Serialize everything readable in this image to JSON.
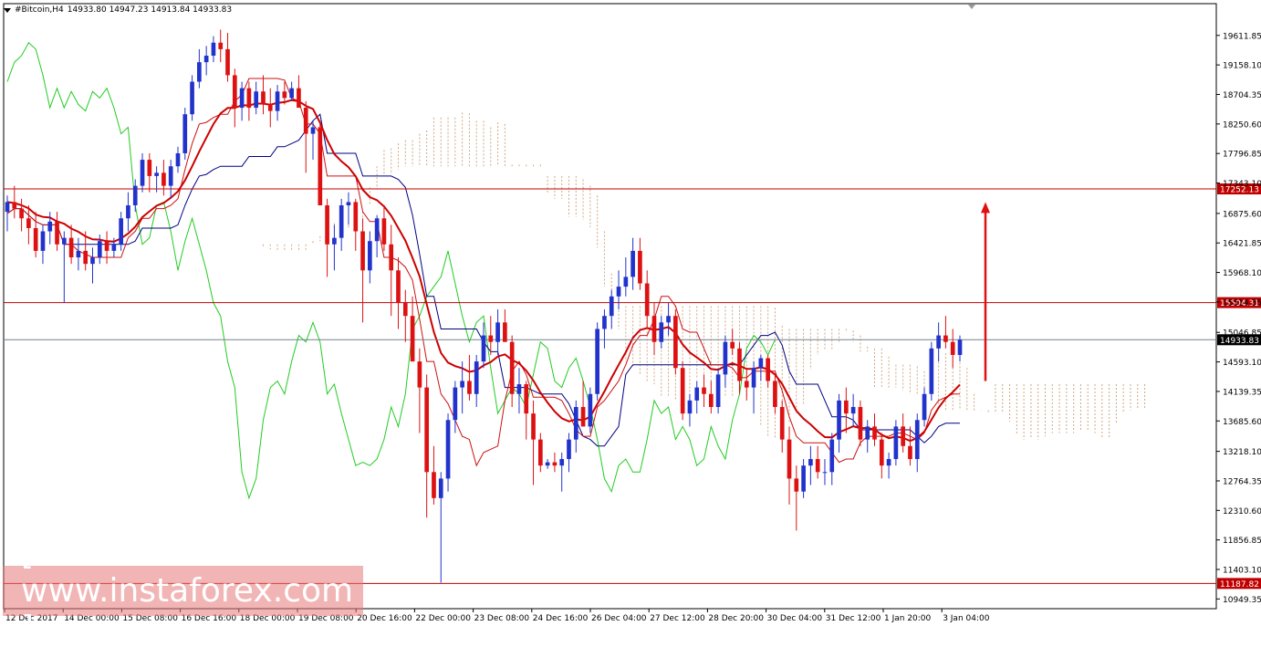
{
  "header": {
    "symbol": "#Bitcoin,H4",
    "ohlc": "14933.80 14947.23 14913.84 14933.83"
  },
  "watermark": {
    "text": "[ www.instaforex.com ]"
  },
  "chart_data": {
    "type": "candlestick",
    "y_axis_ticks": [
      "19611.85",
      "19158.10",
      "18704.35",
      "18250.60",
      "17796.85",
      "17343.10",
      "16875.60",
      "16421.85",
      "15968.10",
      "15514.35",
      "15046.85",
      "14593.10",
      "14139.35",
      "13685.60",
      "13218.10",
      "12764.35",
      "12310.60",
      "11856.85",
      "11403.10",
      "10949.35"
    ],
    "y_axis_tick_values": [
      19611.85,
      19158.1,
      18704.35,
      18250.6,
      17796.85,
      17343.1,
      16875.6,
      16421.85,
      15968.1,
      15514.35,
      15046.85,
      14593.1,
      14139.35,
      13685.6,
      13218.1,
      12764.35,
      12310.6,
      11856.85,
      11403.1,
      10949.35
    ],
    "ylim": [
      10800,
      20100
    ],
    "x_axis_labels": [
      "12 Dec 2017",
      "14 Dec 00:00",
      "15 Dec 08:00",
      "16 Dec 16:00",
      "18 Dec 00:00",
      "19 Dec 08:00",
      "20 Dec 16:00",
      "22 Dec 00:00",
      "23 Dec 08:00",
      "24 Dec 16:00",
      "26 Dec 04:00",
      "27 Dec 12:00",
      "28 Dec 20:00",
      "30 Dec 04:00",
      "31 Dec 12:00",
      "1 Jan 20:00",
      "3 Jan 04:00"
    ],
    "horizontal_levels": [
      {
        "value": 17252.13,
        "label": "17252.13",
        "color": "#c00000"
      },
      {
        "value": 15504.31,
        "label": "15504.31",
        "color": "#c00000"
      },
      {
        "value": 11187.82,
        "label": "11187.82",
        "color": "#c00000"
      }
    ],
    "current_price": {
      "value": 14933.83,
      "label": "14933.83"
    },
    "forecast_arrow": {
      "from": 14300,
      "to": 17050,
      "color": "#e01010"
    },
    "colors": {
      "bull": "#2233cc",
      "bear": "#dd1111",
      "tenkan": "#cc1111",
      "kijun": "#000080",
      "chikou": "#22cc22",
      "ma": "#cc0000",
      "cloud": "#c89060"
    },
    "candles": [
      [
        16900,
        17150,
        16600,
        17050
      ],
      [
        17050,
        17300,
        16800,
        16950
      ],
      [
        16950,
        17100,
        16600,
        16800
      ],
      [
        16800,
        17000,
        16400,
        16650
      ],
      [
        16650,
        16900,
        16200,
        16300
      ],
      [
        16300,
        16700,
        16100,
        16600
      ],
      [
        16600,
        16900,
        16400,
        16750
      ],
      [
        16750,
        16900,
        16300,
        16400
      ],
      [
        16400,
        16600,
        15500,
        16500
      ],
      [
        16500,
        16700,
        16100,
        16200
      ],
      [
        16200,
        16500,
        16000,
        16300
      ],
      [
        16300,
        16600,
        16000,
        16100
      ],
      [
        16100,
        16350,
        15800,
        16200
      ],
      [
        16200,
        16550,
        16100,
        16450
      ],
      [
        16450,
        16600,
        16100,
        16300
      ],
      [
        16300,
        16500,
        16200,
        16400
      ],
      [
        16400,
        16900,
        16300,
        16800
      ],
      [
        16800,
        17200,
        16600,
        17000
      ],
      [
        17000,
        17400,
        16900,
        17300
      ],
      [
        17300,
        17800,
        17200,
        17700
      ],
      [
        17700,
        17800,
        17200,
        17450
      ],
      [
        17450,
        17600,
        17200,
        17500
      ],
      [
        17500,
        17700,
        17150,
        17300
      ],
      [
        17300,
        17700,
        17100,
        17600
      ],
      [
        17600,
        17900,
        17500,
        17800
      ],
      [
        17800,
        18500,
        17700,
        18400
      ],
      [
        18400,
        19000,
        18300,
        18900
      ],
      [
        18900,
        19400,
        18800,
        19200
      ],
      [
        19200,
        19450,
        19000,
        19300
      ],
      [
        19300,
        19600,
        19200,
        19500
      ],
      [
        19500,
        19700,
        19200,
        19400
      ],
      [
        19400,
        19650,
        18900,
        19000
      ],
      [
        19000,
        19100,
        18200,
        18500
      ],
      [
        18500,
        18900,
        18300,
        18800
      ],
      [
        18800,
        18900,
        18300,
        18500
      ],
      [
        18500,
        18900,
        18400,
        18750
      ],
      [
        18750,
        19000,
        18400,
        18550
      ],
      [
        18550,
        18800,
        18200,
        18450
      ],
      [
        18450,
        18850,
        18300,
        18750
      ],
      [
        18750,
        18900,
        18550,
        18650
      ],
      [
        18650,
        18900,
        18600,
        18800
      ],
      [
        18800,
        19000,
        18500,
        18500
      ],
      [
        18500,
        18600,
        17500,
        18100
      ],
      [
        18100,
        18300,
        17700,
        18200
      ],
      [
        18200,
        18300,
        17200,
        17000
      ],
      [
        17000,
        17100,
        15900,
        16400
      ],
      [
        16400,
        16700,
        16000,
        16500
      ],
      [
        16500,
        17100,
        16300,
        17000
      ],
      [
        17000,
        17200,
        16700,
        17050
      ],
      [
        17050,
        17100,
        16300,
        16600
      ],
      [
        16600,
        16800,
        15200,
        16000
      ],
      [
        16000,
        16600,
        15800,
        16450
      ],
      [
        16450,
        16850,
        16200,
        16800
      ],
      [
        16800,
        17000,
        16300,
        16400
      ],
      [
        16400,
        16700,
        15300,
        16000
      ],
      [
        16000,
        16200,
        15100,
        15500
      ],
      [
        15500,
        15700,
        14900,
        15300
      ],
      [
        15300,
        15600,
        14600,
        14600
      ],
      [
        14600,
        14800,
        13500,
        14200
      ],
      [
        14200,
        14400,
        12200,
        12900
      ],
      [
        12900,
        13300,
        12400,
        12500
      ],
      [
        12500,
        12900,
        11200,
        12800
      ],
      [
        12800,
        13800,
        12600,
        13700
      ],
      [
        13700,
        14300,
        13500,
        14200
      ],
      [
        14200,
        14600,
        13800,
        14300
      ],
      [
        14300,
        14700,
        14000,
        14100
      ],
      [
        14100,
        14700,
        13900,
        14600
      ],
      [
        14600,
        15200,
        14500,
        15000
      ],
      [
        15000,
        15300,
        14700,
        14900
      ],
      [
        14900,
        15400,
        14700,
        15200
      ],
      [
        15200,
        15400,
        14900,
        14900
      ],
      [
        14900,
        15000,
        13900,
        14100
      ],
      [
        14100,
        14500,
        13800,
        14250
      ],
      [
        14250,
        14300,
        13400,
        13800
      ],
      [
        13800,
        14000,
        12700,
        13400
      ],
      [
        13400,
        13500,
        12900,
        13000
      ],
      [
        13000,
        13100,
        12950,
        13050
      ],
      [
        13050,
        13200,
        12900,
        13000
      ],
      [
        13000,
        13200,
        12600,
        13100
      ],
      [
        13100,
        13500,
        12900,
        13400
      ],
      [
        13400,
        14000,
        13200,
        13900
      ],
      [
        13900,
        14300,
        13700,
        13600
      ],
      [
        13600,
        14200,
        13500,
        14100
      ],
      [
        14100,
        15200,
        14000,
        15100
      ],
      [
        15100,
        15400,
        14800,
        15300
      ],
      [
        15300,
        15700,
        15100,
        15600
      ],
      [
        15600,
        16000,
        15400,
        15750
      ],
      [
        15750,
        16200,
        15600,
        15900
      ],
      [
        15900,
        16500,
        15700,
        16300
      ],
      [
        16300,
        16500,
        15700,
        15800
      ],
      [
        15800,
        16000,
        15100,
        15300
      ],
      [
        15300,
        15500,
        14700,
        14900
      ],
      [
        14900,
        15300,
        14800,
        15200
      ],
      [
        15200,
        15500,
        15000,
        15300
      ],
      [
        15300,
        15400,
        14400,
        14500
      ],
      [
        14500,
        14600,
        13700,
        13800
      ],
      [
        13800,
        14100,
        13600,
        14000
      ],
      [
        14000,
        14300,
        13800,
        14200
      ],
      [
        14200,
        14400,
        13900,
        14100
      ],
      [
        14100,
        14300,
        13800,
        13900
      ],
      [
        13900,
        14500,
        13800,
        14400
      ],
      [
        14400,
        15000,
        14200,
        14900
      ],
      [
        14900,
        15100,
        14700,
        14800
      ],
      [
        14800,
        14900,
        14100,
        14300
      ],
      [
        14300,
        14500,
        14000,
        14200
      ],
      [
        14200,
        14600,
        13800,
        14500
      ],
      [
        14500,
        14700,
        14300,
        14650
      ],
      [
        14650,
        14700,
        14200,
        14300
      ],
      [
        14300,
        14400,
        13800,
        13900
      ],
      [
        13900,
        14000,
        13200,
        13400
      ],
      [
        13400,
        13600,
        12400,
        12800
      ],
      [
        12800,
        13000,
        12000,
        12600
      ],
      [
        12600,
        13100,
        12500,
        13000
      ],
      [
        13000,
        13300,
        12700,
        13100
      ],
      [
        13100,
        13300,
        12800,
        12900
      ],
      [
        12900,
        13100,
        12700,
        12900
      ],
      [
        12900,
        13500,
        12700,
        13400
      ],
      [
        13400,
        14100,
        13200,
        14000
      ],
      [
        14000,
        14200,
        13500,
        13800
      ],
      [
        13800,
        14100,
        13600,
        13900
      ],
      [
        13900,
        14000,
        13300,
        13400
      ],
      [
        13400,
        13700,
        13200,
        13600
      ],
      [
        13600,
        13800,
        13300,
        13400
      ],
      [
        13400,
        13500,
        12800,
        13000
      ],
      [
        13000,
        13200,
        12800,
        13100
      ],
      [
        13100,
        13700,
        13000,
        13600
      ],
      [
        13600,
        13800,
        13200,
        13300
      ],
      [
        13300,
        13600,
        13000,
        13100
      ],
      [
        13100,
        13800,
        12900,
        13700
      ],
      [
        13700,
        14200,
        13600,
        14100
      ],
      [
        14100,
        14900,
        14000,
        14800
      ],
      [
        14800,
        15200,
        14600,
        15000
      ],
      [
        15000,
        15300,
        14800,
        14900
      ],
      [
        14900,
        15100,
        14500,
        14700
      ],
      [
        14700,
        15000,
        14600,
        14933.83
      ]
    ]
  }
}
